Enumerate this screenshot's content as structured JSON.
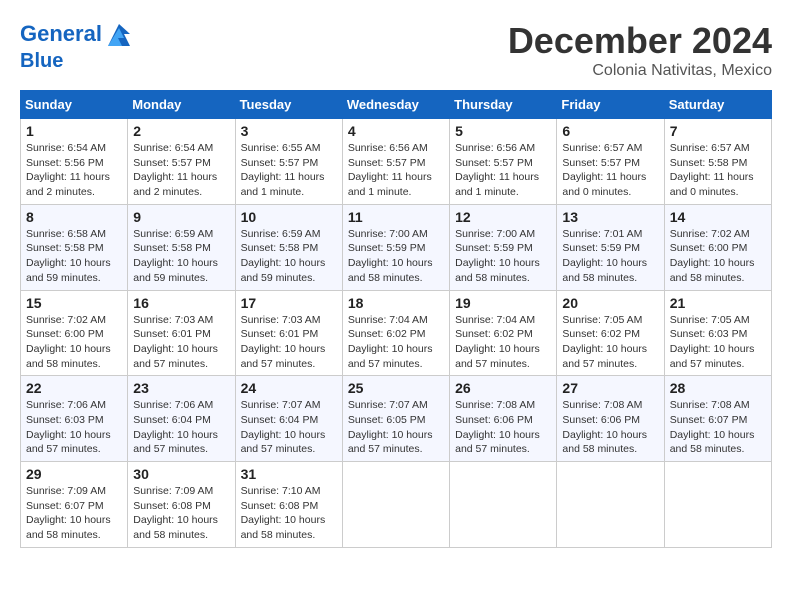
{
  "header": {
    "logo_line1": "General",
    "logo_line2": "Blue",
    "month_title": "December 2024",
    "subtitle": "Colonia Nativitas, Mexico"
  },
  "weekdays": [
    "Sunday",
    "Monday",
    "Tuesday",
    "Wednesday",
    "Thursday",
    "Friday",
    "Saturday"
  ],
  "weeks": [
    [
      {
        "day": "1",
        "info": "Sunrise: 6:54 AM\nSunset: 5:56 PM\nDaylight: 11 hours and 2 minutes."
      },
      {
        "day": "2",
        "info": "Sunrise: 6:54 AM\nSunset: 5:57 PM\nDaylight: 11 hours and 2 minutes."
      },
      {
        "day": "3",
        "info": "Sunrise: 6:55 AM\nSunset: 5:57 PM\nDaylight: 11 hours and 1 minute."
      },
      {
        "day": "4",
        "info": "Sunrise: 6:56 AM\nSunset: 5:57 PM\nDaylight: 11 hours and 1 minute."
      },
      {
        "day": "5",
        "info": "Sunrise: 6:56 AM\nSunset: 5:57 PM\nDaylight: 11 hours and 1 minute."
      },
      {
        "day": "6",
        "info": "Sunrise: 6:57 AM\nSunset: 5:57 PM\nDaylight: 11 hours and 0 minutes."
      },
      {
        "day": "7",
        "info": "Sunrise: 6:57 AM\nSunset: 5:58 PM\nDaylight: 11 hours and 0 minutes."
      }
    ],
    [
      {
        "day": "8",
        "info": "Sunrise: 6:58 AM\nSunset: 5:58 PM\nDaylight: 10 hours and 59 minutes."
      },
      {
        "day": "9",
        "info": "Sunrise: 6:59 AM\nSunset: 5:58 PM\nDaylight: 10 hours and 59 minutes."
      },
      {
        "day": "10",
        "info": "Sunrise: 6:59 AM\nSunset: 5:58 PM\nDaylight: 10 hours and 59 minutes."
      },
      {
        "day": "11",
        "info": "Sunrise: 7:00 AM\nSunset: 5:59 PM\nDaylight: 10 hours and 58 minutes."
      },
      {
        "day": "12",
        "info": "Sunrise: 7:00 AM\nSunset: 5:59 PM\nDaylight: 10 hours and 58 minutes."
      },
      {
        "day": "13",
        "info": "Sunrise: 7:01 AM\nSunset: 5:59 PM\nDaylight: 10 hours and 58 minutes."
      },
      {
        "day": "14",
        "info": "Sunrise: 7:02 AM\nSunset: 6:00 PM\nDaylight: 10 hours and 58 minutes."
      }
    ],
    [
      {
        "day": "15",
        "info": "Sunrise: 7:02 AM\nSunset: 6:00 PM\nDaylight: 10 hours and 58 minutes."
      },
      {
        "day": "16",
        "info": "Sunrise: 7:03 AM\nSunset: 6:01 PM\nDaylight: 10 hours and 57 minutes."
      },
      {
        "day": "17",
        "info": "Sunrise: 7:03 AM\nSunset: 6:01 PM\nDaylight: 10 hours and 57 minutes."
      },
      {
        "day": "18",
        "info": "Sunrise: 7:04 AM\nSunset: 6:02 PM\nDaylight: 10 hours and 57 minutes."
      },
      {
        "day": "19",
        "info": "Sunrise: 7:04 AM\nSunset: 6:02 PM\nDaylight: 10 hours and 57 minutes."
      },
      {
        "day": "20",
        "info": "Sunrise: 7:05 AM\nSunset: 6:02 PM\nDaylight: 10 hours and 57 minutes."
      },
      {
        "day": "21",
        "info": "Sunrise: 7:05 AM\nSunset: 6:03 PM\nDaylight: 10 hours and 57 minutes."
      }
    ],
    [
      {
        "day": "22",
        "info": "Sunrise: 7:06 AM\nSunset: 6:03 PM\nDaylight: 10 hours and 57 minutes."
      },
      {
        "day": "23",
        "info": "Sunrise: 7:06 AM\nSunset: 6:04 PM\nDaylight: 10 hours and 57 minutes."
      },
      {
        "day": "24",
        "info": "Sunrise: 7:07 AM\nSunset: 6:04 PM\nDaylight: 10 hours and 57 minutes."
      },
      {
        "day": "25",
        "info": "Sunrise: 7:07 AM\nSunset: 6:05 PM\nDaylight: 10 hours and 57 minutes."
      },
      {
        "day": "26",
        "info": "Sunrise: 7:08 AM\nSunset: 6:06 PM\nDaylight: 10 hours and 57 minutes."
      },
      {
        "day": "27",
        "info": "Sunrise: 7:08 AM\nSunset: 6:06 PM\nDaylight: 10 hours and 58 minutes."
      },
      {
        "day": "28",
        "info": "Sunrise: 7:08 AM\nSunset: 6:07 PM\nDaylight: 10 hours and 58 minutes."
      }
    ],
    [
      {
        "day": "29",
        "info": "Sunrise: 7:09 AM\nSunset: 6:07 PM\nDaylight: 10 hours and 58 minutes."
      },
      {
        "day": "30",
        "info": "Sunrise: 7:09 AM\nSunset: 6:08 PM\nDaylight: 10 hours and 58 minutes."
      },
      {
        "day": "31",
        "info": "Sunrise: 7:10 AM\nSunset: 6:08 PM\nDaylight: 10 hours and 58 minutes."
      },
      null,
      null,
      null,
      null
    ]
  ]
}
